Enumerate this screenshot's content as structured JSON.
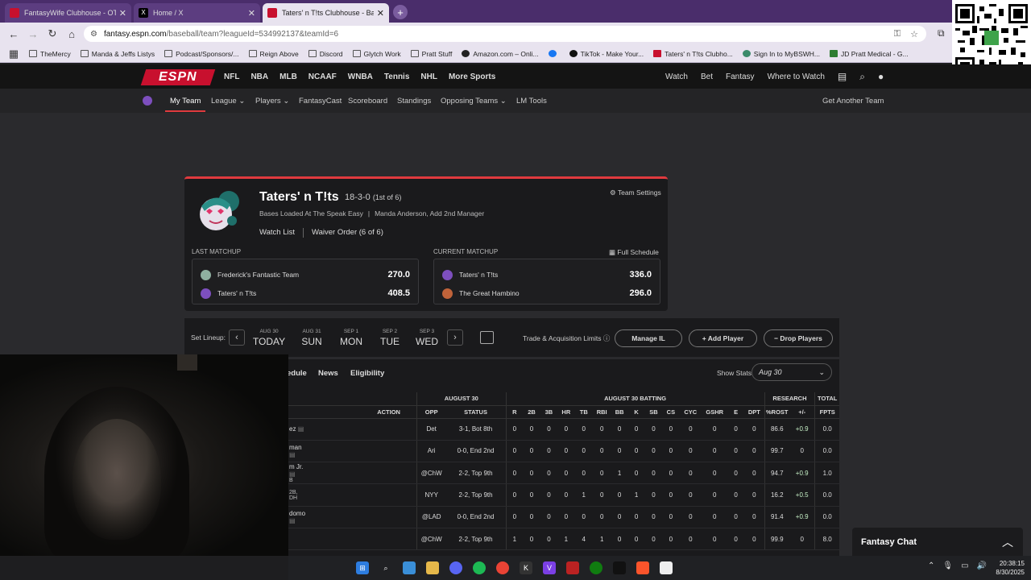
{
  "browser": {
    "tabs": [
      {
        "title": "FantasyWife Clubhouse - OT A:",
        "color": "#c8102e"
      },
      {
        "title": "Home / X",
        "color": "#000000"
      },
      {
        "title": "Taters' n T!ts Clubhouse - Base",
        "color": "#c8102e"
      }
    ],
    "url_host": "fantasy.espn.com",
    "url_path": "/baseball/team?leagueId=534992137&teamId=6",
    "bookmarks": [
      "TheMercy",
      "Manda & Jeffs Listys",
      "Podcast/Sponsors/...",
      "Reign Above",
      "Discord",
      "Glytch Work",
      "Pratt Stuff",
      "Amazon.com – Onli...",
      "",
      "TikTok - Make Your...",
      "Taters' n T!ts Clubho...",
      "Sign In to MyBSWH...",
      "JD Pratt Medical - G..."
    ]
  },
  "espn": {
    "logo": "ESPN",
    "sports": [
      "NFL",
      "NBA",
      "MLB",
      "NCAAF",
      "WNBA",
      "Tennis",
      "NHL",
      "More Sports"
    ],
    "right": [
      "Watch",
      "Bet",
      "Fantasy",
      "Where to Watch"
    ],
    "subnav": {
      "items": [
        "My Team",
        "League",
        "Players",
        "FantasyCast",
        "Scoreboard",
        "Standings",
        "Opposing Teams",
        "LM Tools"
      ],
      "right": "Get Another Team"
    }
  },
  "team": {
    "name": "Taters' n T!ts",
    "record": "18-3-0",
    "rank": "(1st of 6)",
    "settings": "Team Settings",
    "subtitle": "Bases Loaded At The Speak Easy",
    "manager": "Manda Anderson,",
    "add_manager": "Add 2nd Manager",
    "watch_list": "Watch List",
    "waiver": "Waiver Order (6 of 6)"
  },
  "matchups": {
    "last_label": "LAST MATCHUP",
    "current_label": "CURRENT MATCHUP",
    "full_schedule": "Full Schedule",
    "last": [
      {
        "team": "Frederick's Fantastic Team",
        "score": "270.0",
        "color": "#8fb0a0"
      },
      {
        "team": "Taters' n T!ts",
        "score": "408.5",
        "color": "#7d4fbe"
      }
    ],
    "current": [
      {
        "team": "Taters' n T!ts",
        "score": "336.0",
        "color": "#7d4fbe"
      },
      {
        "team": "The Great Hambino",
        "score": "296.0",
        "color": "#c0633a"
      }
    ]
  },
  "lineup": {
    "label": "Set Lineup:",
    "days": [
      {
        "date": "AUG 30",
        "day": "TODAY"
      },
      {
        "date": "AUG 31",
        "day": "SUN"
      },
      {
        "date": "SEP 1",
        "day": "MON"
      },
      {
        "date": "SEP 2",
        "day": "TUE"
      },
      {
        "date": "SEP 3",
        "day": "WED"
      }
    ],
    "trade_limits": "Trade & Acquisition Limits",
    "manage_il": "Manage IL",
    "add_player": "+ Add Player",
    "drop_players": "− Drop Players"
  },
  "table": {
    "tabs": [
      "edule",
      "News",
      "Eligibility"
    ],
    "show_stats": "Show Stats",
    "stats_period": "Aug 30",
    "groups": {
      "batters": "ATTERS",
      "date": "AUGUST 30",
      "batting": "AUGUST 30 BATTING",
      "research": "RESEARCH",
      "total": "TOTAL"
    },
    "columns": [
      "ACTION",
      "OPP",
      "STATUS",
      "R",
      "2B",
      "3B",
      "HR",
      "TB",
      "RBI",
      "BB",
      "K",
      "SB",
      "CS",
      "CYC",
      "GSHR",
      "E",
      "DPT",
      "%ROST",
      "+/-",
      "FPTS"
    ],
    "rows": [
      {
        "player": "ez",
        "line2": "",
        "opp": "Det",
        "status": "3-1, Bot 8th",
        "stats": [
          "0",
          "0",
          "0",
          "0",
          "0",
          "0",
          "0",
          "0",
          "0",
          "0",
          "0",
          "0",
          "0",
          "0"
        ],
        "rost": "86.6",
        "pm": "+0.9",
        "fpts": "0.0"
      },
      {
        "player": "man",
        "line2": "",
        "opp": "Ari",
        "status": "0-0, End 2nd",
        "stats": [
          "0",
          "0",
          "0",
          "0",
          "0",
          "0",
          "0",
          "0",
          "0",
          "0",
          "0",
          "0",
          "0",
          "0"
        ],
        "rost": "99.7",
        "pm": "0",
        "fpts": "0.0"
      },
      {
        "player": "m Jr.",
        "line2": "B",
        "opp": "@ChW",
        "status": "2-2, Top 9th",
        "stats": [
          "0",
          "0",
          "0",
          "0",
          "0",
          "0",
          "1",
          "0",
          "0",
          "0",
          "0",
          "0",
          "0",
          "0"
        ],
        "rost": "94.7",
        "pm": "+0.9",
        "fpts": "1.0"
      },
      {
        "player": "",
        "line2": "2B, DH",
        "opp": "NYY",
        "status": "2-2, Top 9th",
        "stats": [
          "0",
          "0",
          "0",
          "0",
          "1",
          "0",
          "0",
          "1",
          "0",
          "0",
          "0",
          "0",
          "0",
          "0"
        ],
        "rost": "16.2",
        "pm": "+0.5",
        "fpts": "0.0"
      },
      {
        "player": "domo",
        "line2": "",
        "opp": "@LAD",
        "status": "0-0, End 2nd",
        "stats": [
          "0",
          "0",
          "0",
          "0",
          "0",
          "0",
          "0",
          "0",
          "0",
          "0",
          "0",
          "0",
          "0",
          "0"
        ],
        "rost": "91.4",
        "pm": "+0.9",
        "fpts": "0.0"
      },
      {
        "player": "",
        "line2": "",
        "opp": "@ChW",
        "status": "2-2, Top 9th",
        "stats": [
          "1",
          "0",
          "0",
          "1",
          "4",
          "1",
          "0",
          "0",
          "0",
          "0",
          "0",
          "0",
          "0",
          "0"
        ],
        "rost": "99.9",
        "pm": "0",
        "fpts": "8.0"
      }
    ]
  },
  "chat": {
    "label": "Fantasy Chat"
  },
  "clock": {
    "time": "20:38:15",
    "date": "8/30/2025"
  }
}
